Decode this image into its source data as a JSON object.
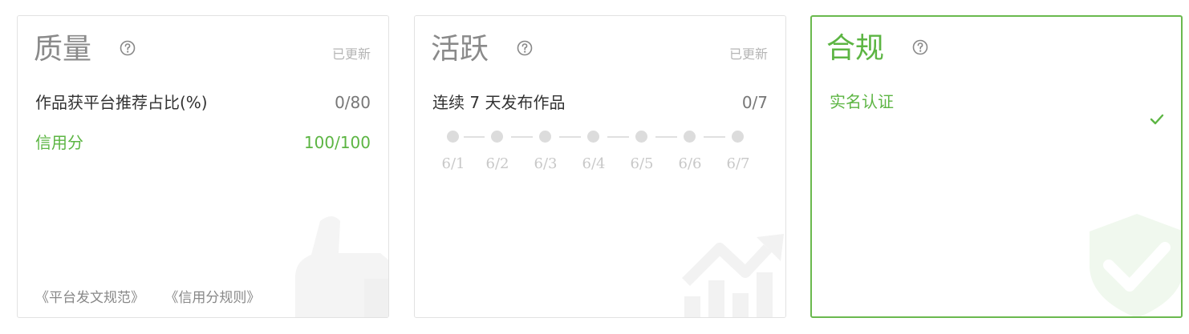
{
  "cards": {
    "quality": {
      "title": "质量",
      "status": "已更新",
      "rows": [
        {
          "label": "作品获平台推荐占比(%)",
          "value": "0/80"
        },
        {
          "label": "信用分",
          "value": "100/100"
        }
      ],
      "links": [
        "《平台发文规范》",
        "《信用分规则》"
      ]
    },
    "activity": {
      "title": "活跃",
      "status": "已更新",
      "row": {
        "label": "连续 7 天发布作品",
        "value": "0/7"
      },
      "dates": [
        "6/1",
        "6/2",
        "6/3",
        "6/4",
        "6/5",
        "6/6",
        "6/7"
      ]
    },
    "compliance": {
      "title": "合规",
      "row": {
        "label": "实名认证"
      }
    }
  },
  "colors": {
    "accent": "#5cb543",
    "muted": "#8a8a8a",
    "border": "#e2e2e2"
  },
  "icons": [
    "help-icon",
    "check-icon",
    "thumbs-up-icon",
    "chart-trend-icon",
    "shield-check-icon"
  ]
}
